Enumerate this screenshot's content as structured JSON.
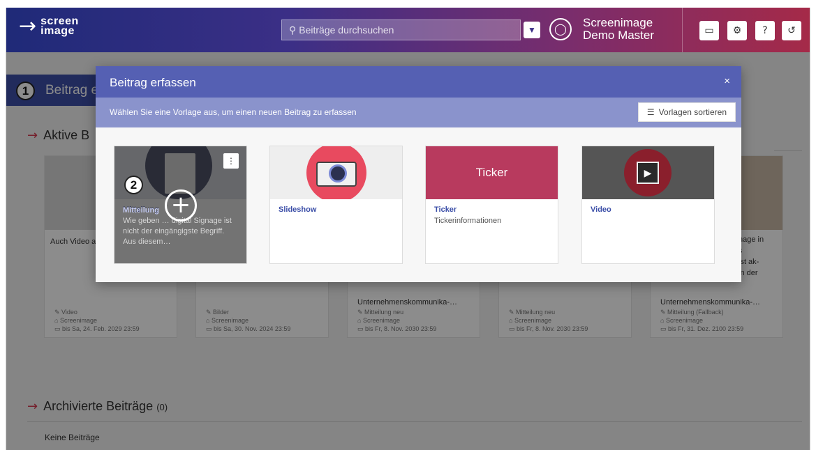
{
  "header": {
    "logo_line1": "screen",
    "logo_line2": "image",
    "search_placeholder": "Beiträge durchsuchen",
    "user_line1": "Screenimage",
    "user_line2": "Demo Master"
  },
  "background": {
    "tab_label": "Beitrag e",
    "badge1": "1",
    "active_section": "Aktive B",
    "archived_section": "Archivierte Beiträge",
    "archived_count": "(0)",
    "no_posts": "Keine Beiträge",
    "cards": [
      {
        "text": "Auch Video aufschalten",
        "type": "Video",
        "location": "Screenimage",
        "until": "bis Sa, 24. Feb. 2029 23:59"
      },
      {
        "text": "",
        "type": "Bilder",
        "location": "Screenimage",
        "until": "bis Sa, 30. Nov. 2024 23:59"
      },
      {
        "text": "Unternehmenskommunika-…",
        "type": "Mitteilung neu",
        "location": "Screenimage",
        "until": "bis Fr, 8. Nov. 2030 23:59"
      },
      {
        "text": "",
        "type": "Mitteilung neu",
        "location": "Screenimage",
        "until": "bis Fr, 8. Nov. 2030 23:59"
      },
      {
        "text": "Unternehmenskommunika-…",
        "type": "Mitteilung (Fallback)",
        "location": "Screenimage",
        "until": "bis Fr, 31. Dez. 2100 23:59"
      }
    ],
    "card5_extra": [
      "nage in",
      "s",
      "ist ak-",
      "in der"
    ]
  },
  "modal": {
    "title": "Beitrag erfassen",
    "close": "×",
    "subtitle": "Wählen Sie eine Vorlage aus, um einen neuen Beitrag zu erfassen",
    "sort_label": "Vorlagen sortieren",
    "badge2": "2",
    "templates": [
      {
        "title": "Mitteilung",
        "desc": "Wie geben … digital Si­gnage ist nicht der eingän­gigste Begriff. Aus diesem…"
      },
      {
        "title": "Slideshow",
        "desc": ""
      },
      {
        "title": "Ticker",
        "desc": "Tickerinformationen",
        "banner": "Ticker"
      },
      {
        "title": "Video",
        "desc": ""
      }
    ]
  },
  "colors": {
    "accent": "#3c4fa8",
    "modal_head": "#5560b3",
    "ticker": "#b83a5e",
    "camera": "#e84a5f"
  }
}
